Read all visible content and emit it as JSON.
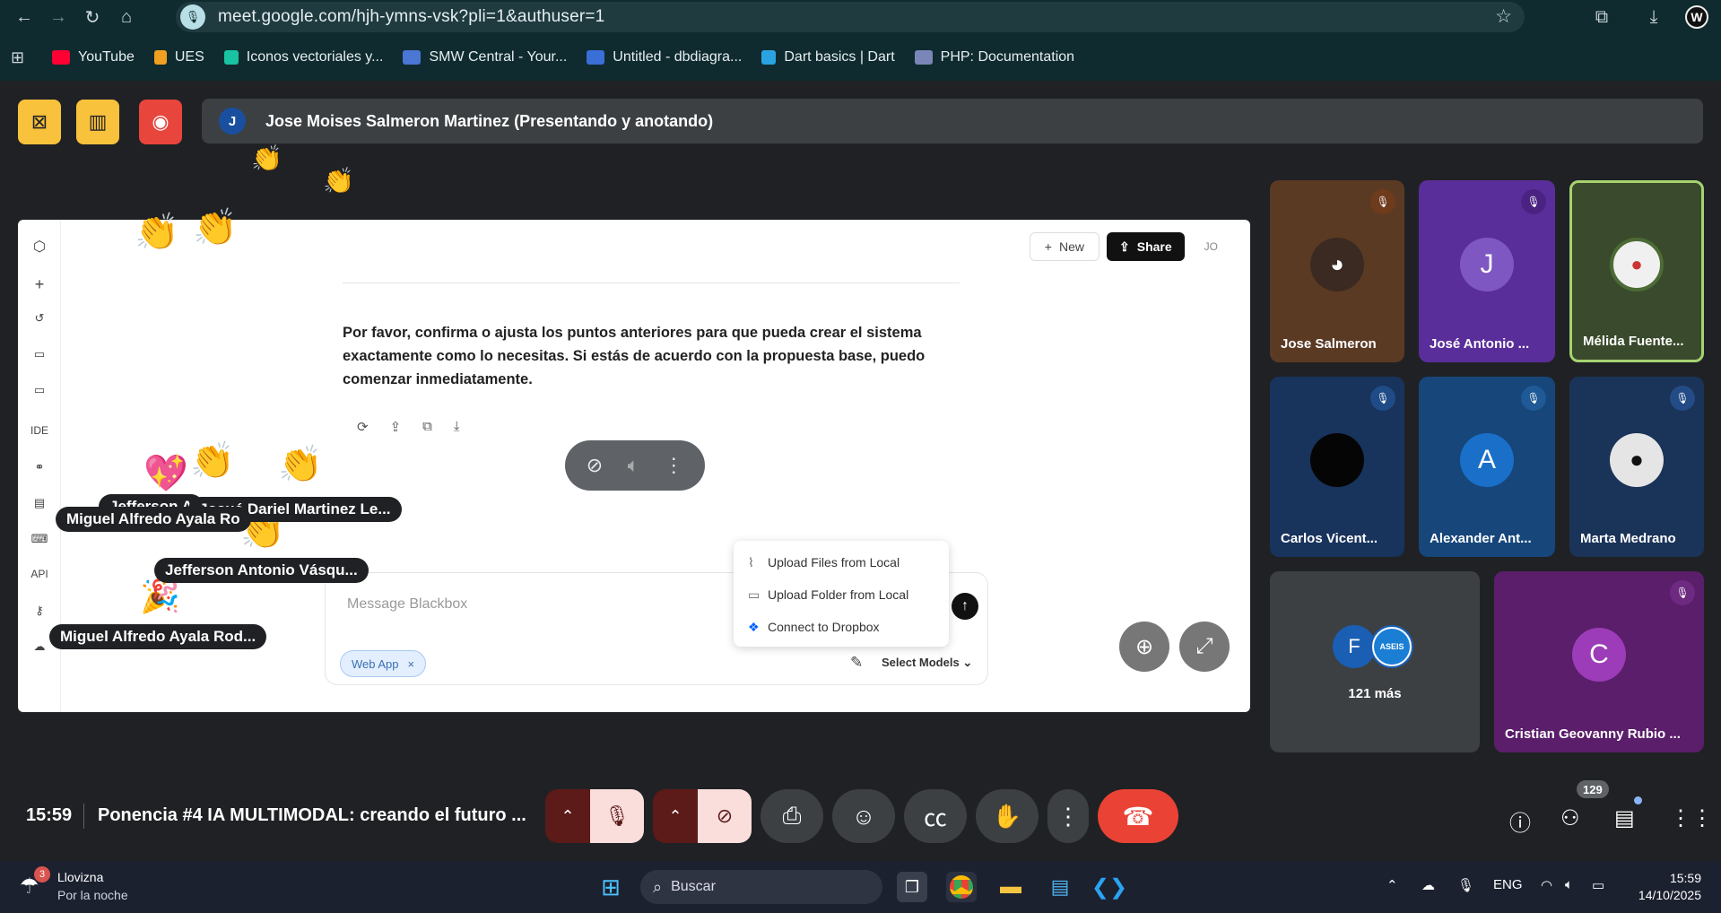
{
  "browser": {
    "url": "meet.google.com/hjh-ymns-vsk?pli=1&authuser=1",
    "profile_initial": "W",
    "bookmarks": [
      {
        "label": "YouTube",
        "color": "#ff0033"
      },
      {
        "label": "UES",
        "color": "#f0a020"
      },
      {
        "label": "Iconos vectoriales y...",
        "color": "#19c2a0"
      },
      {
        "label": "SMW Central - Your...",
        "color": "#4a77d4"
      },
      {
        "label": "Untitled - dbdiagra...",
        "color": "#3b6fd8"
      },
      {
        "label": "Dart basics | Dart",
        "color": "#2ba3e0"
      },
      {
        "label": "PHP: Documentation",
        "color": "#7a86b8"
      }
    ]
  },
  "meet": {
    "presenter_initial": "J",
    "presenter_text": "Jose Moises Salmeron Martinez (Presentando y anotando)",
    "shared": {
      "rail_labels": {
        "ide": "IDE",
        "api": "API"
      },
      "new_label": "New",
      "share_label": "Share",
      "user_initials": "JO",
      "message": "Por favor, confirma o ajusta los puntos anteriores para que pueda crear el sistema exactamente como lo necesitas. Si estás de acuerdo con la propuesta base, puedo comenzar inmediatamente.",
      "composer_placeholder": "Message Blackbox",
      "chip_label": "Web App",
      "chip_close": "×",
      "models_label": "Select Models",
      "upload_menu": [
        {
          "label": "Upload Files from Local",
          "icon": "paperclip-icon"
        },
        {
          "label": "Upload Folder from Local",
          "icon": "folder-icon"
        },
        {
          "label": "Connect to Dropbox",
          "icon": "dropbox-icon"
        }
      ]
    },
    "reaction_tags": {
      "jefferson_1": "Jefferson A",
      "josue": "Josué Dariel Martinez Le...",
      "miguel_1": "Miguel Alfredo Ayala Ro",
      "jefferson_2": "Jefferson Antonio Vásqu...",
      "miguel_2": "Miguel Alfredo Ayala Rod..."
    },
    "participants": [
      {
        "name": "Jose Salmeron",
        "muted": true
      },
      {
        "name": "José Antonio ...",
        "initial": "J",
        "muted": true
      },
      {
        "name": "Mélida Fuente...",
        "muted": false,
        "speaking": true
      },
      {
        "name": "Carlos Vicent...",
        "muted": true
      },
      {
        "name": "Alexander Ant...",
        "initial": "A",
        "muted": true
      },
      {
        "name": "Marta Medrano",
        "muted": true
      },
      {
        "name": "121 más",
        "initial": "F"
      },
      {
        "name": "Cristian Geovanny Rubio ...",
        "initial": "C",
        "muted": true
      }
    ],
    "others_badge": "ASEIS",
    "bottom": {
      "time": "15:59",
      "title": "Ponencia #4 IA MULTIMODAL: creando el futuro ...",
      "participant_count": "129"
    }
  },
  "taskbar": {
    "weather_badge": "3",
    "weather_title": "Llovizna",
    "weather_sub": "Por la noche",
    "search_label": "Buscar",
    "lang": "ENG",
    "time": "15:59",
    "date": "14/10/2025"
  }
}
